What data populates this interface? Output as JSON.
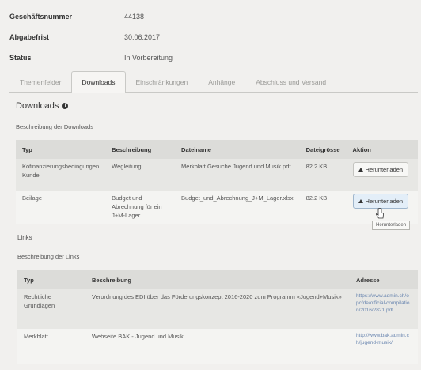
{
  "info": [
    {
      "label": "Geschäftsnummer",
      "value": "44138"
    },
    {
      "label": "Abgabefrist",
      "value": "30.06.2017"
    },
    {
      "label": "Status",
      "value": "In Vorbereitung"
    }
  ],
  "tabs": [
    "Themenfelder",
    "Downloads",
    "Einschränkungen",
    "Anhänge",
    "Abschluss und Versand"
  ],
  "active_tab": "Downloads",
  "downloads": {
    "title": "Downloads",
    "subtitle": "Beschreibung der Downloads",
    "columns": [
      "Typ",
      "Beschreibung",
      "Dateiname",
      "Dateigrösse",
      "Aktion"
    ],
    "rows": [
      {
        "typ": "Kofinanzierungsbedingungen Kunde",
        "beschreibung": "Wegleitung",
        "dateiname": "Merkblatt Gesuche Jugend und Musik.pdf",
        "groesse": "82.2 KB",
        "aktion": "Herunterladen"
      },
      {
        "typ": "Beilage",
        "beschreibung": "Budget und Abrechnung für ein J+M-Lager",
        "dateiname": "Budget_und_Abrechnung_J+M_Lager.xlsx",
        "groesse": "82.2 KB",
        "aktion": "Herunterladen"
      }
    ],
    "tooltip": "Herunterladen"
  },
  "links": {
    "title": "Links",
    "subtitle": "Beschreibung der Links",
    "columns": [
      "Typ",
      "Beschreibung",
      "Adresse"
    ],
    "rows": [
      {
        "typ": "Rechtliche Grundlagen",
        "beschreibung": "Verordnung des EDI über das Förderungskonzept 2016-2020 zum Programm «Jugend+Musik»",
        "adresse": "https://www.admin.ch/opc/de/official-compilation/2016/2821.pdf"
      },
      {
        "typ": "Merkblatt",
        "beschreibung": "Webseite BAK - Jugend und Musik",
        "adresse": "http://www.bak.admin.ch/jugend-musik/"
      }
    ]
  },
  "colors": {
    "accent": "#6a86b0",
    "header_bg": "#dcdcd9"
  }
}
